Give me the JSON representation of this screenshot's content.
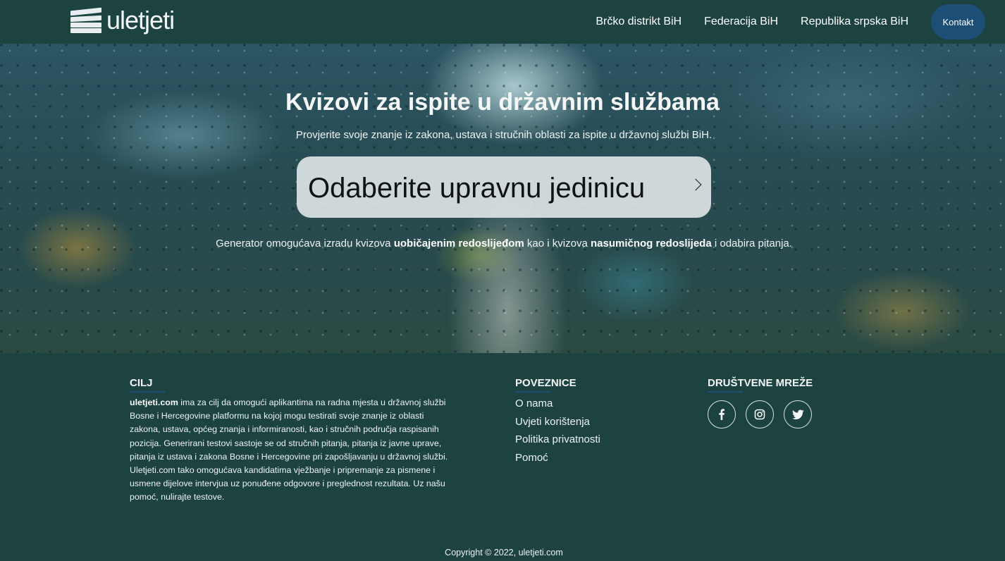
{
  "nav": {
    "logo_text": "uletjeti",
    "links": [
      "Brčko distrikt BiH",
      "Federacija BiH",
      "Republika srpska BiH"
    ],
    "contact": "Kontakt"
  },
  "hero": {
    "title": "Kvizovi za ispite u državnim službama",
    "subtitle": "Provjerite svoje znanje iz zakona, ustava i stručnih oblasti za ispite u državnoj službi BiH.",
    "selector_label": "Odaberite upravnu jedinicu",
    "generator_pre": "Generator omogućava izradu kvizova ",
    "generator_bold1": "uobičajenim redoslijeđom",
    "generator_mid": " kao i kvizova ",
    "generator_bold2": "nasumičnog redoslijeda",
    "generator_post": " i odabira pitanja."
  },
  "footer": {
    "cilj_heading": "CILJ",
    "cilj_brand": "uletjeti.com",
    "cilj_text": " ima za cilj da omogući aplikantima na radna mjesta u državnoj službi Bosne i Hercegovine platformu na kojoj mogu testirati svoje znanje iz oblasti zakona, ustava, općeg znanja i informiranosti, kao i stručnih područja raspisanih pozicija. Generirani testovi sastoje se od stručnih pitanja, pitanja iz javne uprave, pitanja iz ustava i zakona Bosne i Hercegovine pri zapošljavanju u državnoj službi. Uletjeti.com tako omogućava kandidatima vježbanje i pripremanje za pismene i usmene dijelove intervjua uz ponuđene odgovore i preglednost rezultata. Uz našu pomoć, nulirajte testove.",
    "links_heading": "POVEZNICE",
    "links": [
      "O nama",
      "Uvjeti korištenja",
      "Politika privatnosti",
      "Pomoć"
    ],
    "social_heading": "DRUŠTVENE MREŽE",
    "social": [
      "facebook-icon",
      "instagram-icon",
      "twitter-icon"
    ],
    "copyright": "Copyright © 2022, uletjeti.com"
  },
  "colors": {
    "background": "#1c4340",
    "accent": "#1d4e76"
  }
}
